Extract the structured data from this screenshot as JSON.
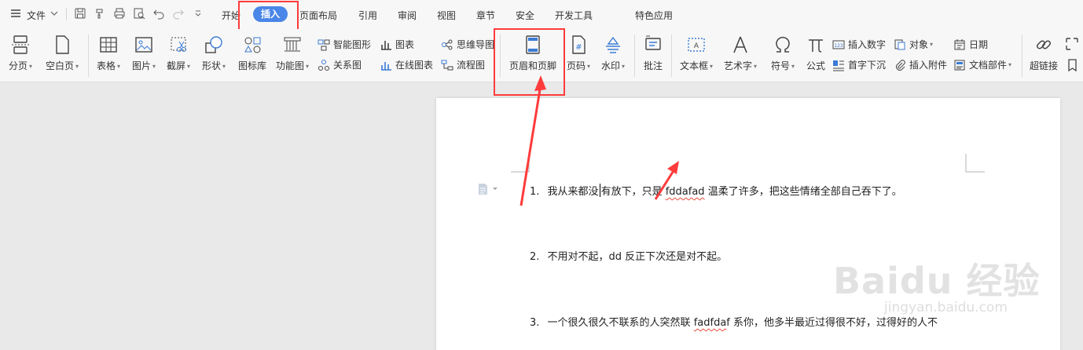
{
  "menubar": {
    "file_label": "文件",
    "tabs": [
      "开始",
      "插入",
      "页面布局",
      "引用",
      "审阅",
      "视图",
      "章节",
      "安全",
      "开发工具",
      "特色应用"
    ],
    "active_tab": "插入"
  },
  "ribbon": {
    "page_break": "分页",
    "blank_page": "空白页",
    "table": "表格",
    "picture": "图片",
    "screenshot": "截屏",
    "shape": "形状",
    "icon_library": "图标库",
    "function_chart": "功能图",
    "smart_art": "智能图形",
    "relation_chart": "关系图",
    "chart": "图表",
    "online_chart": "在线图表",
    "mind_map": "思维导图",
    "flowchart": "流程图",
    "header_footer": "页眉和页脚",
    "page_number": "页码",
    "watermark": "水印",
    "comment": "批注",
    "text_box": "文本框",
    "word_art": "艺术字",
    "symbol": "符号",
    "formula": "公式",
    "insert_number": "插入数字",
    "drop_cap": "首字下沉",
    "object": "对象",
    "attachment": "插入附件",
    "date": "日期",
    "doc_parts": "文档部件",
    "hyperlink": "超链接"
  },
  "document": {
    "paragraphs": [
      {
        "num": "1.",
        "pre": "我从来都没",
        "mid": "有放下，只是",
        "err": "fddafad",
        "post": "温柔了许多，把这些情绪全部自己吞下了。"
      },
      {
        "num": "2.",
        "text": "不用对不起，dd 反正下次还是对不起。"
      },
      {
        "num": "3.",
        "pre": "一个很久很久不联系的人突然联",
        "err": "fadfda",
        "post": "f 系你，他多半最近过得很不好，过得好的人不"
      }
    ]
  },
  "watermark_text": "Baidu 经验",
  "watermark_sub": "jingyan.baidu.com",
  "colors": {
    "accent": "#4a86e8",
    "annotation": "#ff3b3b"
  }
}
